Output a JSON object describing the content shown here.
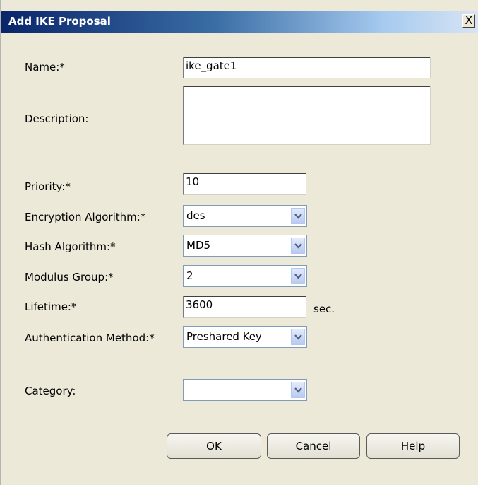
{
  "dialog": {
    "title": "Add IKE Proposal",
    "close_symbol": "X"
  },
  "fields": {
    "name": {
      "label": "Name:*",
      "value": "ike_gate1"
    },
    "description": {
      "label": "Description:",
      "value": ""
    },
    "priority": {
      "label": "Priority:*",
      "value": "10"
    },
    "encryption": {
      "label": "Encryption Algorithm:*",
      "value": "des"
    },
    "hash": {
      "label": "Hash Algorithm:*",
      "value": "MD5"
    },
    "modulus": {
      "label": "Modulus Group:*",
      "value": "2"
    },
    "lifetime": {
      "label": "Lifetime:*",
      "value": "3600",
      "unit": "sec."
    },
    "auth": {
      "label": "Authentication Method:*",
      "value": "Preshared Key"
    },
    "category": {
      "label": "Category:",
      "value": ""
    }
  },
  "buttons": {
    "ok": "OK",
    "cancel": "Cancel",
    "help": "Help"
  },
  "icons": {
    "close": "close-icon",
    "dropdown": "chevron-down-icon"
  }
}
